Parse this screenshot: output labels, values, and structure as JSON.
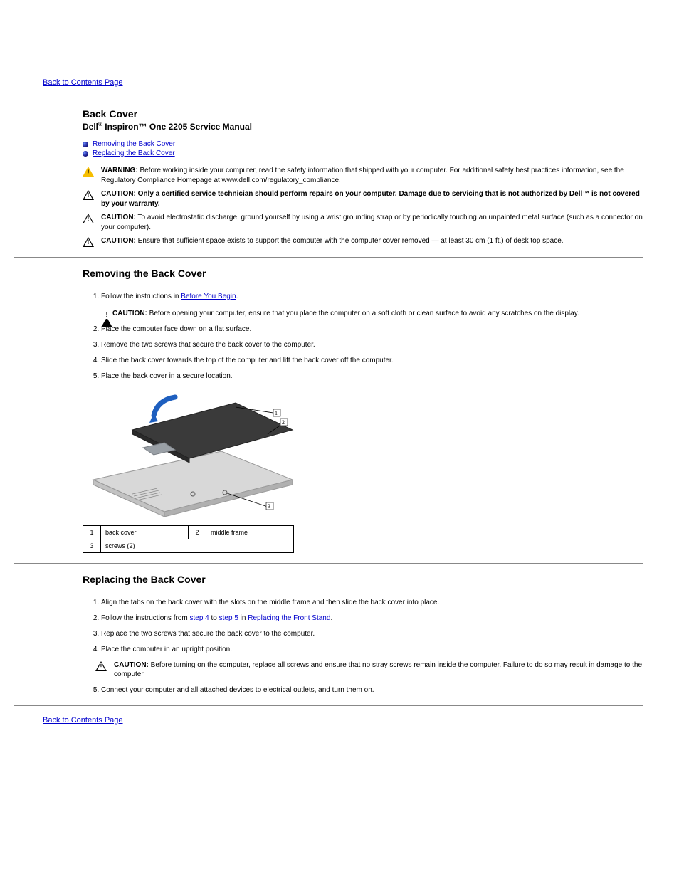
{
  "nav": {
    "back_top": "Back to Contents Page",
    "back_bottom": "Back to Contents Page"
  },
  "header": {
    "title": "Back Cover",
    "subtitle_prefix": "Dell",
    "subtitle_rest": " Inspiron™ One 2205 Service Manual"
  },
  "toc": [
    {
      "label": "Removing the Back Cover"
    },
    {
      "label": "Replacing the Back Cover"
    }
  ],
  "notices": {
    "warning_label": "WARNING:",
    "warning_text": " Before working inside your computer, read the safety information that shipped with your computer. For additional safety best practices information, see the Regulatory Compliance Homepage at www.dell.com/regulatory_compliance.",
    "caution1_label": "CAUTION:",
    "caution1_text": " Only a certified service technician should perform repairs on your computer. Damage due to servicing that is not authorized by Dell™ is not covered by your warranty.",
    "caution2_label": "CAUTION:",
    "caution2_text": " To avoid electrostatic discharge, ground yourself by using a wrist grounding strap or by periodically touching an unpainted metal surface (such as a connector on your computer).",
    "caution3_label": "CAUTION:",
    "caution3_text": " Ensure that sufficient space exists to support the computer with the computer cover removed — at least 30 cm (1 ft.) of desk top space."
  },
  "removing": {
    "heading": "Removing the Back Cover",
    "steps": {
      "s1_prefix": "Follow the instructions in ",
      "s1_link": "Before You Begin",
      "s1_suffix": ".",
      "s2_label": "CAUTION:",
      "s2_text": " Before opening your computer, ensure that you place the computer on a soft cloth or clean surface to avoid any scratches on the display.",
      "s3": "Place the computer face down on a flat surface.",
      "s4": "Remove the two screws that secure the back cover to the computer.",
      "s5": "Slide the back cover towards the top of the computer and lift the back cover off the computer.",
      "s6": "Place the back cover in a secure location."
    }
  },
  "callouts_table": {
    "r1n": "1",
    "r1l": "back cover",
    "r2n": "2",
    "r2l": "middle frame",
    "r3n": "3",
    "r3l": "screws (2)"
  },
  "replacing": {
    "heading": "Replacing the Back Cover",
    "steps": {
      "s1": "Align the tabs on the back cover with the slots on the middle frame and then slide the back cover into place.",
      "s2": "Replace the two screws that secure the back cover to the computer.",
      "s3": "Place the computer in an upright position.",
      "s4_label": "CAUTION:",
      "s4_text": " Before turning on the computer, replace all screws and ensure that no stray screws remain inside the computer. Failure to do so may result in damage to the computer.",
      "s5_prefix": "Connect your computer and all attached devices to electrical outlets, and turn them on.",
      "s5_linked_prefix": "Follow the instructions from ",
      "s5_link1": "step 4",
      "s5_mid": " to ",
      "s5_link2": "step 5",
      "s5_linked_suffix": " in ",
      "s5_link3": "Replacing the Front Stand",
      "s5_end": "."
    }
  }
}
